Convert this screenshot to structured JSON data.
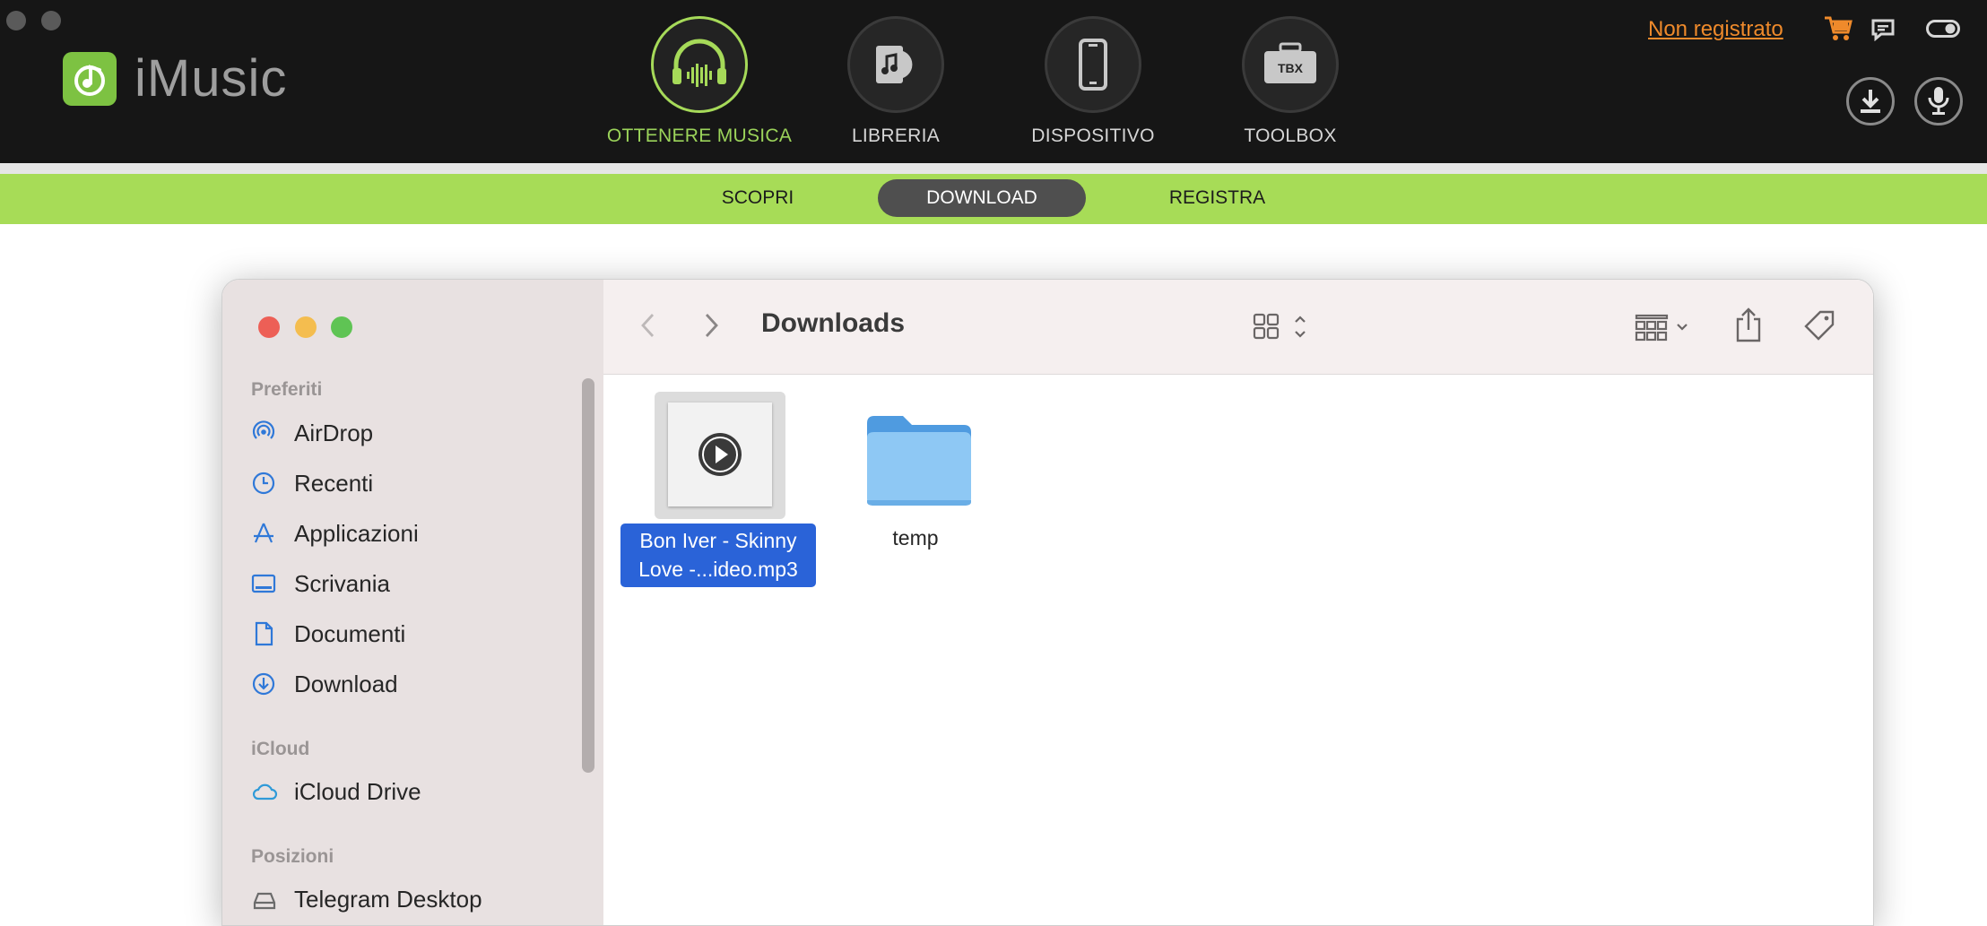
{
  "app": {
    "name": "iMusic",
    "register_link": "Non registrato",
    "nav": [
      {
        "label": "OTTENERE MUSICA",
        "icon": "headphones-icon",
        "active": true
      },
      {
        "label": "LIBRERIA",
        "icon": "library-icon",
        "active": false
      },
      {
        "label": "DISPOSITIVO",
        "icon": "phone-icon",
        "active": false
      },
      {
        "label": "TOOLBOX",
        "icon": "toolbox-icon",
        "active": false
      }
    ],
    "toolbox_badge": "TBX",
    "subtabs": [
      {
        "label": "SCOPRI",
        "active": false
      },
      {
        "label": "DOWNLOAD",
        "active": true
      },
      {
        "label": "REGISTRA",
        "active": false
      }
    ],
    "colors": {
      "accent": "#a7dc57",
      "link": "#ef8a2b",
      "topbar": "#161616"
    }
  },
  "finder": {
    "title": "Downloads",
    "sidebar": {
      "sections": [
        {
          "title": "Preferiti",
          "items": [
            {
              "label": "AirDrop",
              "icon": "airdrop-icon"
            },
            {
              "label": "Recenti",
              "icon": "clock-icon"
            },
            {
              "label": "Applicazioni",
              "icon": "apps-icon"
            },
            {
              "label": "Scrivania",
              "icon": "desktop-icon"
            },
            {
              "label": "Documenti",
              "icon": "document-icon"
            },
            {
              "label": "Download",
              "icon": "download-circle-icon"
            }
          ]
        },
        {
          "title": "iCloud",
          "items": [
            {
              "label": "iCloud Drive",
              "icon": "cloud-icon"
            }
          ]
        },
        {
          "title": "Posizioni",
          "items": [
            {
              "label": "Telegram Desktop",
              "icon": "drive-icon"
            }
          ]
        }
      ]
    },
    "files": [
      {
        "name_line1": "Bon Iver - Skinny",
        "name_line2": "Love -...ideo.mp3",
        "type": "audio",
        "selected": true
      },
      {
        "name": "temp",
        "type": "folder",
        "selected": false
      }
    ],
    "colors": {
      "selection": "#2a63d8",
      "sidebar": "#e8e1e1"
    }
  }
}
